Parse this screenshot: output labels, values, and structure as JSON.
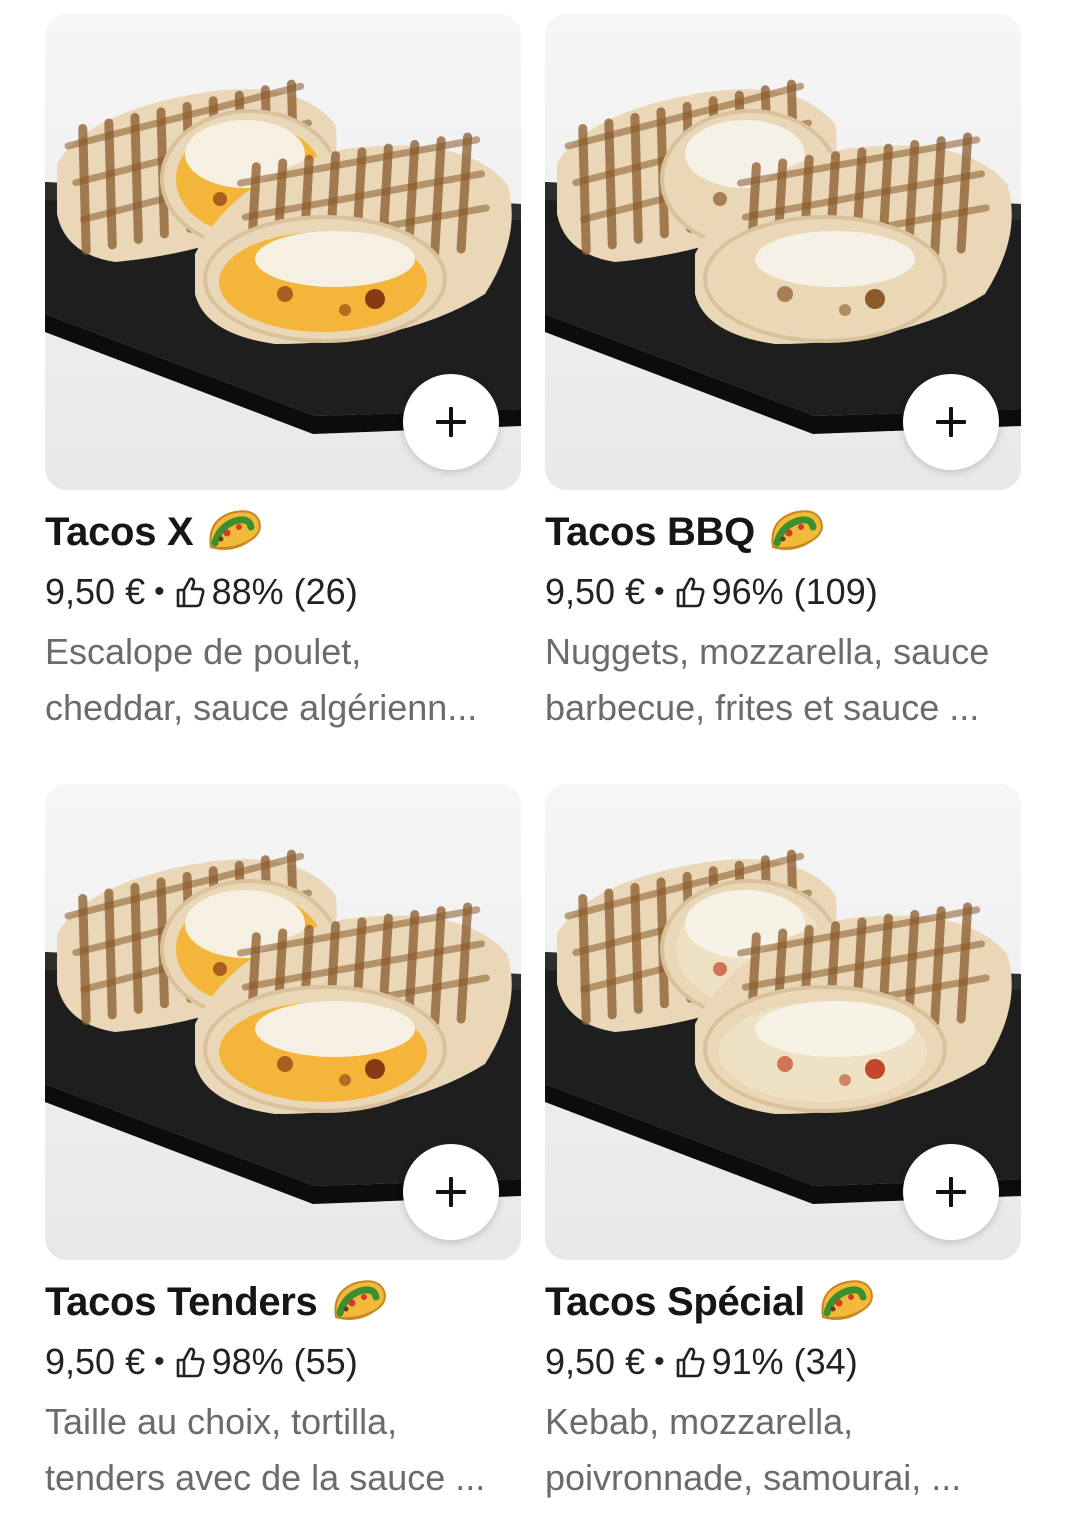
{
  "items": [
    {
      "name": "Tacos X",
      "price": "9,50 €",
      "separator": "•",
      "rating": "88% (26)",
      "desc_line1": "Escalope de poulet,",
      "desc_line2": "cheddar, sauce algérienn...",
      "add_label": "+",
      "filling": "cheddar"
    },
    {
      "name": "Tacos BBQ",
      "price": "9,50 €",
      "separator": "•",
      "rating": "96% (109)",
      "desc_line1": "Nuggets, mozzarella, sauce",
      "desc_line2": "barbecue, frites et sauce ...",
      "add_label": "+",
      "filling": "white"
    },
    {
      "name": "Tacos Tenders",
      "price": "9,50 €",
      "separator": "•",
      "rating": "98% (55)",
      "desc_line1": "Taille au choix, tortilla,",
      "desc_line2": "tenders avec de la sauce ...",
      "add_label": "+",
      "filling": "cheddar"
    },
    {
      "name": "Tacos Spécial",
      "price": "9,50 €",
      "separator": "•",
      "rating": "91% (34)",
      "desc_line1": "Kebab, mozzarella,",
      "desc_line2": "poivronnade, samourai, ...",
      "add_label": "+",
      "filling": "veggie"
    }
  ],
  "icons": {
    "add": "plus-icon",
    "emoji": "taco-icon",
    "rating": "thumbs-up-icon"
  },
  "colors": {
    "text": "#161616",
    "muted": "#6b6b6b",
    "card_bg": "#efefef",
    "tortilla": "#e9d7b8",
    "grill": "#8a5a2b",
    "plate": "#1e1e1e"
  }
}
